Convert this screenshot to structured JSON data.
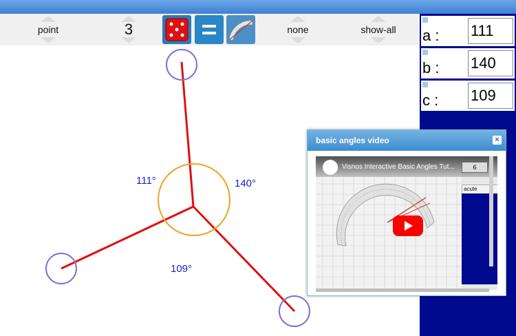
{
  "toolbar": {
    "mode": "point",
    "count": "3",
    "label_mode": "none",
    "show_mode": "show-all"
  },
  "values": [
    {
      "name": "a :",
      "value": "111"
    },
    {
      "name": "b :",
      "value": "140"
    },
    {
      "name": "c :",
      "value": "109"
    }
  ],
  "angles": {
    "a": "111°",
    "b": "140°",
    "c": "109°"
  },
  "colors": {
    "rays": "#e01010",
    "handles": "#7b6fd8",
    "angle_circle": "#f0a020",
    "angle_labels": "#1c1cd0",
    "panel": "#000a8f"
  },
  "icons": [
    "dice-icon",
    "equals-icon",
    "protractor-icon",
    "close-icon",
    "play-icon"
  ],
  "video": {
    "panel_title": "basic angles video",
    "video_title": "Visnos Interactive Basic Angles Tut...",
    "embedded_value": "6",
    "embedded_option": "acute"
  }
}
